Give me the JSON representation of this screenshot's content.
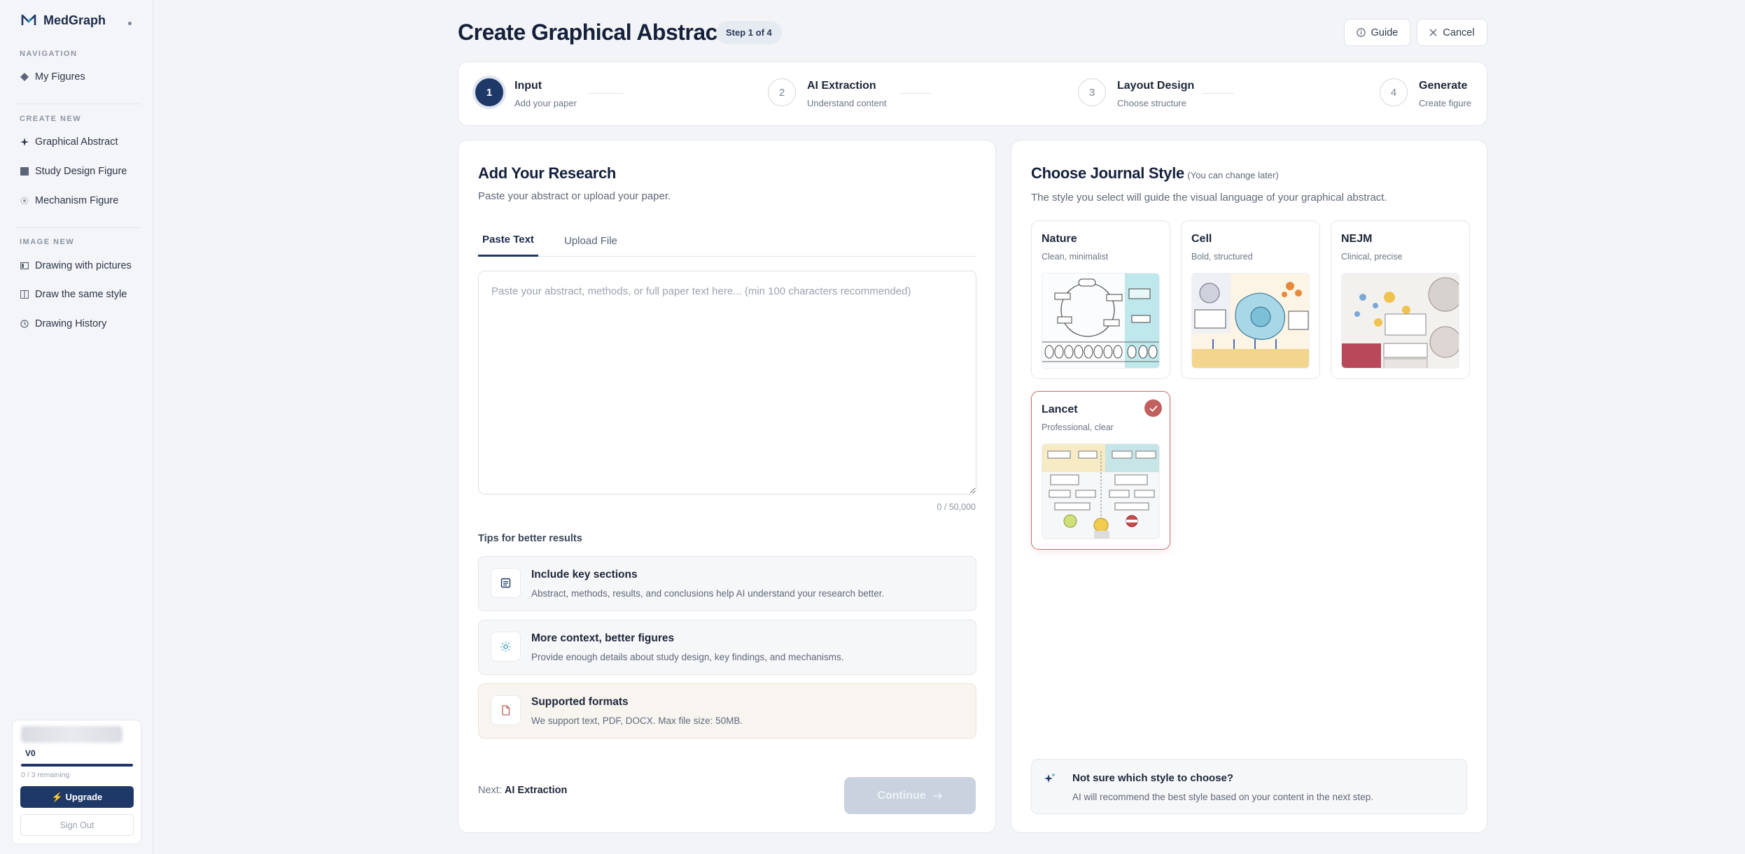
{
  "sidebar": {
    "brand": "MedGraph",
    "sections": [
      {
        "label": "NAVIGATION",
        "items": [
          {
            "label": "My Figures",
            "icon": "diamond-icon"
          }
        ]
      },
      {
        "label": "CREATE NEW",
        "items": [
          {
            "label": "Graphical Abstract",
            "icon": "sparkle-icon"
          },
          {
            "label": "Study Design Figure",
            "icon": "grid-icon"
          },
          {
            "label": "Mechanism Figure",
            "icon": "atom-icon"
          }
        ]
      },
      {
        "label": "IMAGE NEW",
        "items": [
          {
            "label": "Drawing with pictures",
            "icon": "image-icon"
          },
          {
            "label": "Draw the same style",
            "icon": "copy-icon"
          },
          {
            "label": "Drawing History",
            "icon": "clock-icon"
          }
        ]
      }
    ],
    "usage": {
      "plan": "V0",
      "remaining": "0 / 3 remaining",
      "progress": 1.0,
      "upgrade_label": "⚡ Upgrade",
      "signout_label": "Sign Out"
    }
  },
  "header": {
    "title": "Create Graphical Abstract",
    "step_badge": "Step 1 of 4",
    "guide_label": "Guide",
    "cancel_label": "Cancel"
  },
  "stepper": [
    {
      "num": "1",
      "name": "Input",
      "sub": "Add your paper",
      "active": true
    },
    {
      "num": "2",
      "name": "AI Extraction",
      "sub": "Understand content",
      "active": false
    },
    {
      "num": "3",
      "name": "Layout Design",
      "sub": "Choose structure",
      "active": false
    },
    {
      "num": "4",
      "name": "Generate",
      "sub": "Create figure",
      "active": false
    }
  ],
  "research": {
    "title": "Add Your Research",
    "subtitle": "Paste your abstract or upload your paper.",
    "tabs": [
      {
        "label": "Paste Text",
        "active": true
      },
      {
        "label": "Upload File",
        "active": false
      }
    ],
    "textarea_placeholder": "Paste your abstract, methods, or full paper text here... (min 100 characters recommended)",
    "textarea_value": "",
    "counter": "0 / 50,000",
    "tips_title": "Tips for better results",
    "tips": [
      {
        "title": "Include key sections",
        "desc": "Abstract, methods, results, and conclusions help AI understand your research better.",
        "icon": "document-icon"
      },
      {
        "title": "More context, better figures",
        "desc": "Provide enough details about study design, key findings, and mechanisms.",
        "icon": "sun-icon"
      },
      {
        "title": "Supported formats",
        "desc": "We support text, PDF, DOCX. Max file size: 50MB.",
        "icon": "file-icon"
      }
    ],
    "next_prefix": "Next:",
    "next_step": "AI Extraction",
    "continue_label": "Continue"
  },
  "journal": {
    "title": "Choose Journal Style",
    "title_note": "(You can change later)",
    "subtitle": "The style you select will guide the visual language of your graphical abstract.",
    "styles": [
      {
        "name": "Nature",
        "desc": "Clean, minimalist",
        "selected": false
      },
      {
        "name": "Cell",
        "desc": "Bold, structured",
        "selected": false
      },
      {
        "name": "NEJM",
        "desc": "Clinical, precise",
        "selected": false
      },
      {
        "name": "Lancet",
        "desc": "Professional, clear",
        "selected": true
      }
    ],
    "recommend_title": "Not sure which style to choose?",
    "recommend_desc": "AI will recommend the best style based on your content in the next step."
  },
  "colors": {
    "accent": "#1e3868",
    "selected": "#c0615f"
  }
}
